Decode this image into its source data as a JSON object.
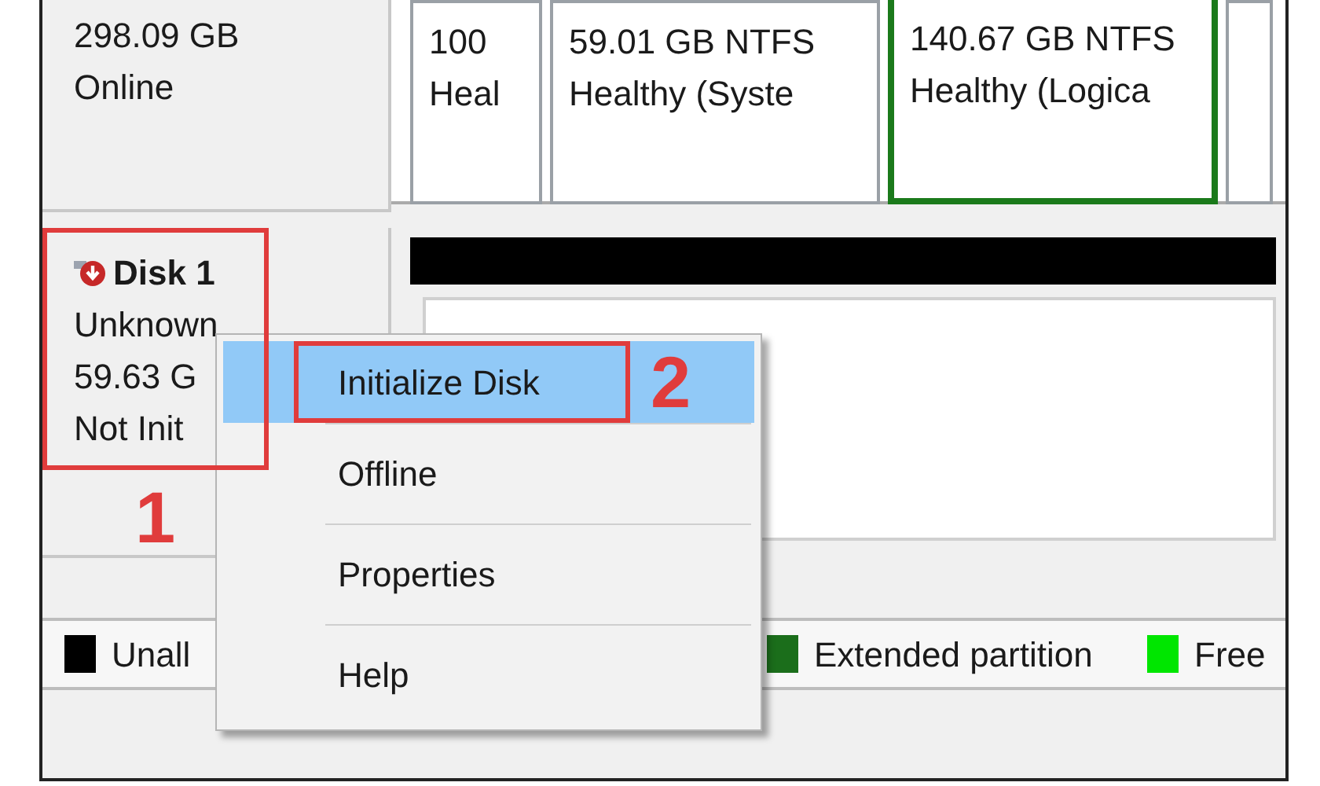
{
  "disk_0": {
    "info": [
      "298.09 GB",
      "Online"
    ],
    "partitions": [
      {
        "kind": "primary",
        "lines": [
          "100",
          "Heal"
        ]
      },
      {
        "kind": "primary",
        "lines": [
          "59.01 GB NTFS",
          "Healthy (Syste"
        ]
      },
      {
        "kind": "logical",
        "lines": [
          "140.67 GB NTFS",
          "Healthy (Logica"
        ]
      },
      {
        "kind": "primary"
      }
    ]
  },
  "disk_1": {
    "title": "Disk 1",
    "info": [
      "Unknown",
      "59.63 G",
      "Not Init"
    ],
    "bar": {
      "kind": "unallocated"
    }
  },
  "legend": [
    {
      "label": "Unall",
      "color": "#000000"
    },
    {
      "label": "Extended partition",
      "color": "#1b6e1b"
    },
    {
      "label": "Free",
      "color": "#00e600"
    }
  ],
  "context_menu": {
    "items": [
      {
        "label": "Initialize Disk",
        "selected": true
      },
      {
        "label": "Offline",
        "selected": false
      },
      {
        "label": "Properties",
        "selected": false
      },
      {
        "label": "Help",
        "selected": false
      }
    ]
  },
  "annotations": [
    {
      "label": "1"
    },
    {
      "label": "2"
    }
  ]
}
